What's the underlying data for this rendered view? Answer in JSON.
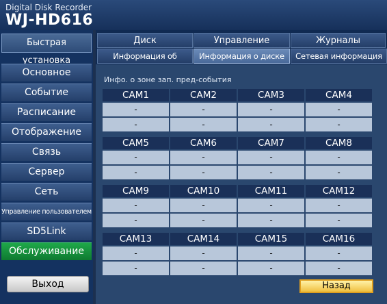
{
  "header": {
    "subtitle": "Digital Disk Recorder",
    "model": "WJ-HD616"
  },
  "sidebar": {
    "quick_setup": "Быстрая установка",
    "items": [
      {
        "label": "Основное"
      },
      {
        "label": "Событие"
      },
      {
        "label": "Расписание"
      },
      {
        "label": "Отображение"
      },
      {
        "label": "Связь"
      },
      {
        "label": "Сервер"
      },
      {
        "label": "Сеть"
      },
      {
        "label": "Управление пользователем"
      },
      {
        "label": "SD5Link"
      },
      {
        "label": "Обслуживание"
      }
    ],
    "active_item": "Обслуживание",
    "exit": "Выход"
  },
  "tabs": {
    "row1": [
      "Диск",
      "Управление уставками",
      "Журналы"
    ],
    "row2": [
      "Информация об изделии",
      "Информация о диске",
      "Сетевая информация"
    ],
    "active": "Информация о диске"
  },
  "content": {
    "title": "Инфо. о зоне зап. пред-события",
    "cameras": [
      {
        "name": "CAM1",
        "values": [
          "-",
          "-"
        ]
      },
      {
        "name": "CAM2",
        "values": [
          "-",
          "-"
        ]
      },
      {
        "name": "CAM3",
        "values": [
          "-",
          "-"
        ]
      },
      {
        "name": "CAM4",
        "values": [
          "-",
          "-"
        ]
      },
      {
        "name": "CAM5",
        "values": [
          "-",
          "-"
        ]
      },
      {
        "name": "CAM6",
        "values": [
          "-",
          "-"
        ]
      },
      {
        "name": "CAM7",
        "values": [
          "-",
          "-"
        ]
      },
      {
        "name": "CAM8",
        "values": [
          "-",
          "-"
        ]
      },
      {
        "name": "CAM9",
        "values": [
          "-",
          "-"
        ]
      },
      {
        "name": "CAM10",
        "values": [
          "-",
          "-"
        ]
      },
      {
        "name": "CAM11",
        "values": [
          "-",
          "-"
        ]
      },
      {
        "name": "CAM12",
        "values": [
          "-",
          "-"
        ]
      },
      {
        "name": "CAM13",
        "values": [
          "-",
          "-"
        ]
      },
      {
        "name": "CAM14",
        "values": [
          "-",
          "-"
        ]
      },
      {
        "name": "CAM15",
        "values": [
          "-",
          "-"
        ]
      },
      {
        "name": "CAM16",
        "values": [
          "-",
          "-"
        ]
      }
    ],
    "back": "Назад"
  },
  "colors": {
    "active_menu": "#1fa84a",
    "back_button": "#f0c040",
    "cell_bg": "#b8c7da"
  }
}
